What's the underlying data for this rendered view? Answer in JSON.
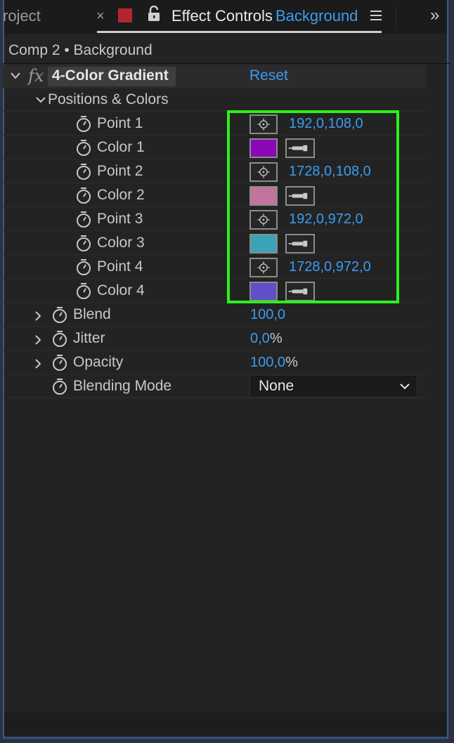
{
  "tabs": {
    "project_label": "roject",
    "close_glyph": "×",
    "active_title": "Effect Controls",
    "active_layer": "Background",
    "overflow_glyph": "»",
    "swatch_color": "#b3262d"
  },
  "breadcrumb": "Comp 2 • Background",
  "effect": {
    "fx": "fx",
    "name": "4-Color Gradient",
    "reset_label": "Reset"
  },
  "group": {
    "label": "Positions & Colors"
  },
  "params": [
    {
      "label": "Point 1",
      "value": "192,0,108,0"
    },
    {
      "label": "Color 1",
      "color": "#8c07b5"
    },
    {
      "label": "Point 2",
      "value": "1728,0,108,0"
    },
    {
      "label": "Color 2",
      "color": "#c1749e"
    },
    {
      "label": "Point 3",
      "value": "192,0,972,0"
    },
    {
      "label": "Color 3",
      "color": "#3ba3b6"
    },
    {
      "label": "Point 4",
      "value": "1728,0,972,0"
    },
    {
      "label": "Color 4",
      "color": "#5f4fc8"
    }
  ],
  "props": {
    "blend": {
      "label": "Blend",
      "value": "100,0",
      "unit": ""
    },
    "jitter": {
      "label": "Jitter",
      "value": "0,0",
      "unit": "%"
    },
    "opacity": {
      "label": "Opacity",
      "value": "100,0",
      "unit": "%"
    },
    "blending_mode": {
      "label": "Blending Mode",
      "value": "None"
    }
  },
  "colors": {
    "accent": "#3b9cf0",
    "highlight": "#2cf01c"
  },
  "icons": {
    "stopwatch": "stopwatch-icon",
    "crosshair": "crosshair-icon",
    "eyedropper": "eyedropper-icon"
  }
}
